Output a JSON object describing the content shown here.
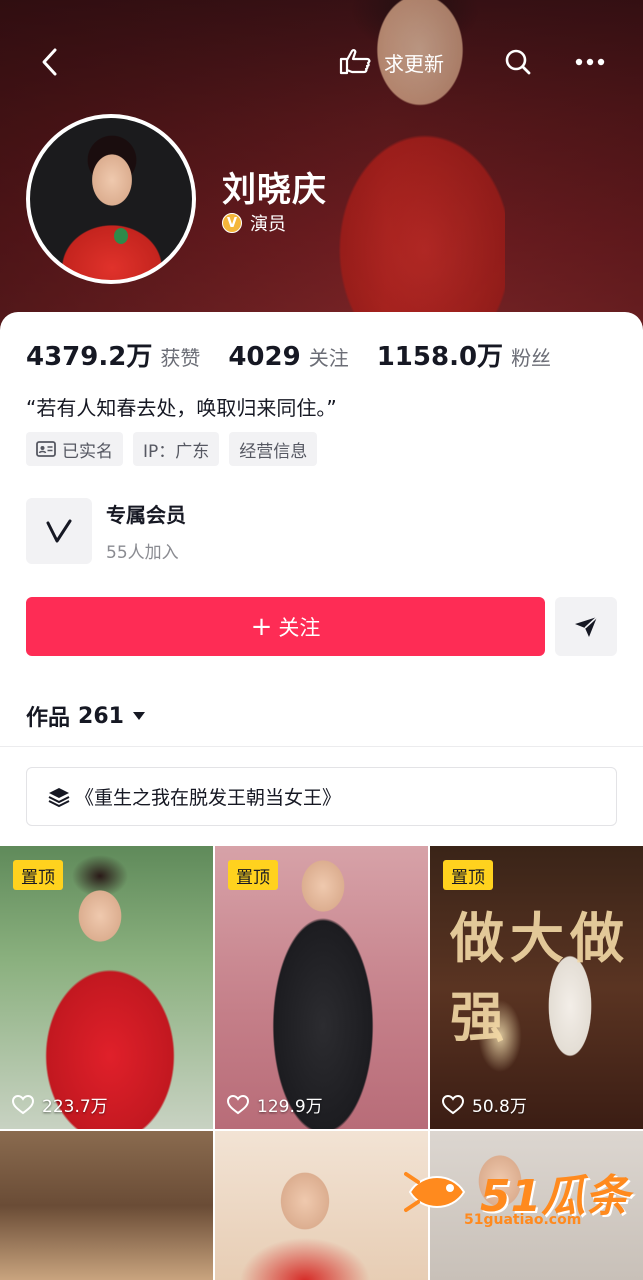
{
  "header": {
    "ask_update_label": "求更新"
  },
  "profile": {
    "name": "刘晓庆",
    "verified_title": "演员",
    "verify_badge": "V"
  },
  "stats": [
    {
      "value": "4379.2万",
      "label": "获赞"
    },
    {
      "value": "4029",
      "label": "关注"
    },
    {
      "value": "1158.0万",
      "label": "粉丝"
    }
  ],
  "bio": "“若有人知春去处，唤取归来同住。”",
  "tags": [
    {
      "label": "已实名",
      "icon": "id-card-icon"
    },
    {
      "label": "IP：广东"
    },
    {
      "label": "经营信息"
    }
  ],
  "membership": {
    "title": "专属会员",
    "subtitle": "55人加入"
  },
  "actions": {
    "follow_label": "关注",
    "follow_prefix": "+"
  },
  "works": {
    "label": "作品",
    "count": "261"
  },
  "collection": {
    "title": "《重生之我在脱发王朝当女王》"
  },
  "pinned_label": "置顶",
  "videos": [
    {
      "pinned": true,
      "likes": "223.7万"
    },
    {
      "pinned": true,
      "likes": "129.9万"
    },
    {
      "pinned": true,
      "likes": "50.8万",
      "overlay_text": "做大做强"
    },
    {
      "pinned": false,
      "likes": ""
    },
    {
      "pinned": false,
      "likes": ""
    },
    {
      "pinned": false,
      "likes": ""
    }
  ],
  "watermark": {
    "text": "51瓜条",
    "sub": "51guatiao.com"
  },
  "colors": {
    "accent": "#fe2c55",
    "pin_bg": "#ffd21e",
    "verify": "#f4b63a"
  }
}
